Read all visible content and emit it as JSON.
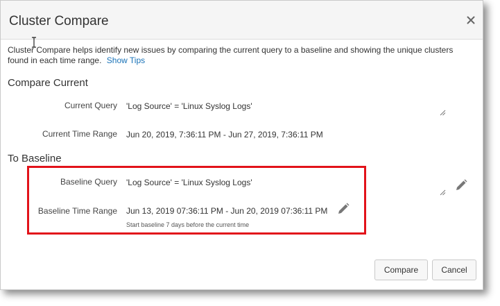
{
  "dialog": {
    "title": "Cluster Compare",
    "close_label": "×"
  },
  "description": {
    "text": "Cluster Compare helps identify new issues by comparing the current query to a baseline and showing the unique clusters found in each time range.",
    "link": "Show Tips"
  },
  "compare_current": {
    "heading": "Compare Current",
    "query_label": "Current Query",
    "query_value": "'Log Source' = 'Linux Syslog Logs'",
    "time_label": "Current Time Range",
    "time_value": "Jun 20, 2019, 7:36:11 PM - Jun 27, 2019, 7:36:11 PM"
  },
  "baseline": {
    "heading": "To Baseline",
    "query_label": "Baseline Query",
    "query_value": "'Log Source' = 'Linux Syslog Logs'",
    "time_label": "Baseline Time Range",
    "time_value": "Jun 13, 2019 07:36:11 PM - Jun 20, 2019 07:36:11 PM",
    "time_hint": "Start baseline 7 days before the current time"
  },
  "buttons": {
    "compare": "Compare",
    "cancel": "Cancel"
  },
  "colors": {
    "highlight": "#e2121a",
    "link": "#1a73b8"
  }
}
